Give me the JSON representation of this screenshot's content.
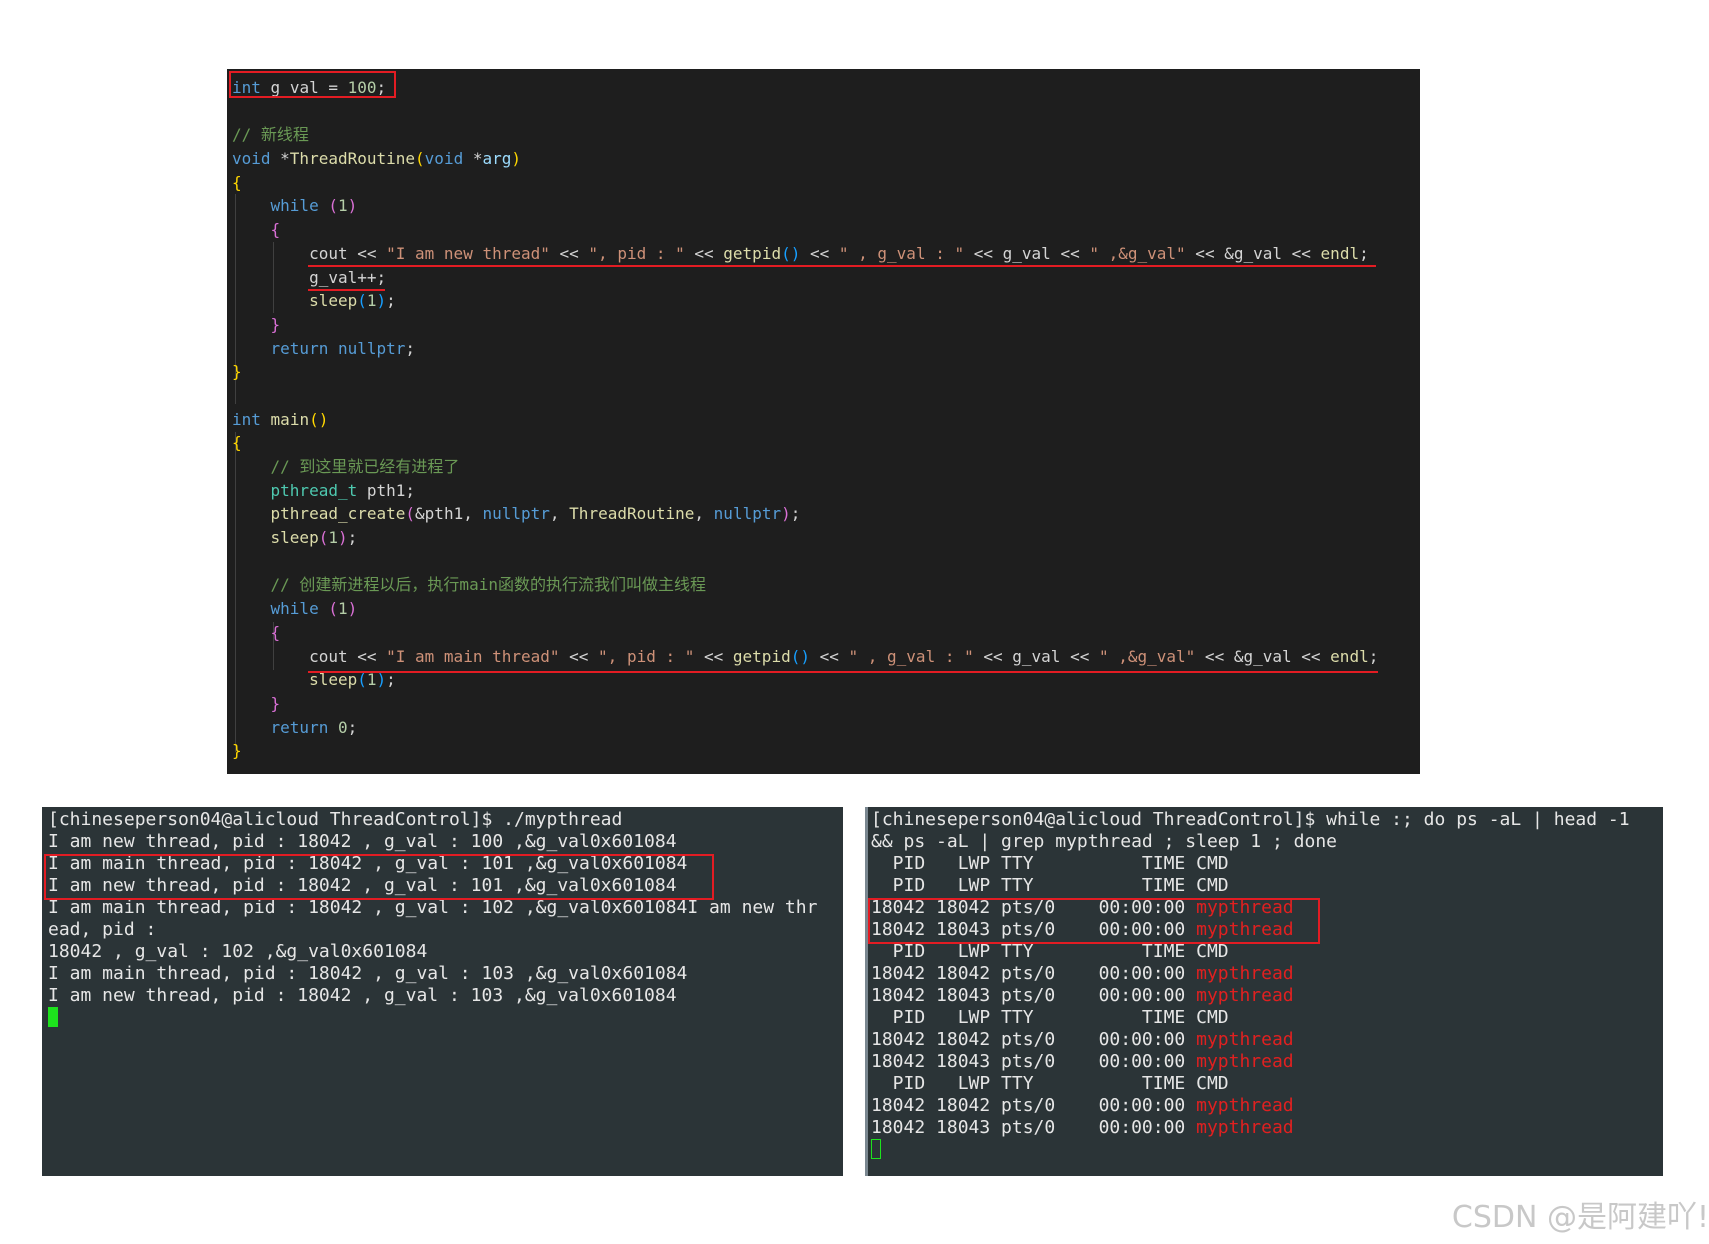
{
  "code_editor": {
    "lines": [
      "int g_val = 100;",
      "",
      "// 新线程",
      "void *ThreadRoutine(void *arg)",
      "{",
      "    while (1)",
      "    {",
      "        cout << \"I am new thread\" << \", pid : \" << getpid() << \" , g_val : \" << g_val << \" ,&g_val\" << &g_val << endl;",
      "        g_val++;",
      "        sleep(1);",
      "    }",
      "    return nullptr;",
      "}",
      "",
      "int main()",
      "{",
      "    // 到这里就已经有进程了",
      "    pthread_t pth1;",
      "    pthread_create(&pth1, nullptr, ThreadRoutine, nullptr);",
      "    sleep(1);",
      "",
      "    // 创建新进程以后，执行main函数的执行流我们叫做主线程",
      "    while (1)",
      "    {",
      "        cout << \"I am main thread\" << \", pid : \" << getpid() << \" , g_val : \" << g_val << \" ,&g_val\" << &g_val << endl;",
      "        sleep(1);",
      "    }",
      "    return 0;",
      "}"
    ]
  },
  "terminal_left": {
    "lines": [
      "[chineseperson04@alicloud ThreadControl]$ ./mypthread",
      "I am new thread, pid : 18042 , g_val : 100 ,&g_val0x601084",
      "I am main thread, pid : 18042 , g_val : 101 ,&g_val0x601084",
      "I am new thread, pid : 18042 , g_val : 101 ,&g_val0x601084",
      "I am main thread, pid : 18042 , g_val : 102 ,&g_val0x601084I am new thr",
      "ead, pid :",
      "18042 , g_val : 102 ,&g_val0x601084",
      "I am main thread, pid : 18042 , g_val : 103 ,&g_val0x601084",
      "I am new thread, pid : 18042 , g_val : 103 ,&g_val0x601084"
    ]
  },
  "terminal_right": {
    "command": [
      "[chineseperson04@alicloud ThreadControl]$ while :; do ps -aL | head -1",
      "&& ps -aL | grep mypthread ; sleep 1 ; done"
    ],
    "rows": [
      {
        "text": "  PID   LWP TTY          TIME CMD",
        "cmd": ""
      },
      {
        "text": "  PID   LWP TTY          TIME CMD",
        "cmd": ""
      },
      {
        "text": "18042 18042 pts/0    00:00:00 ",
        "cmd": "mypthread"
      },
      {
        "text": "18042 18043 pts/0    00:00:00 ",
        "cmd": "mypthread"
      },
      {
        "text": "  PID   LWP TTY          TIME CMD",
        "cmd": ""
      },
      {
        "text": "18042 18042 pts/0    00:00:00 ",
        "cmd": "mypthread"
      },
      {
        "text": "18042 18043 pts/0    00:00:00 ",
        "cmd": "mypthread"
      },
      {
        "text": "  PID   LWP TTY          TIME CMD",
        "cmd": ""
      },
      {
        "text": "18042 18042 pts/0    00:00:00 ",
        "cmd": "mypthread"
      },
      {
        "text": "18042 18043 pts/0    00:00:00 ",
        "cmd": "mypthread"
      },
      {
        "text": "  PID   LWP TTY          TIME CMD",
        "cmd": ""
      },
      {
        "text": "18042 18042 pts/0    00:00:00 ",
        "cmd": "mypthread"
      },
      {
        "text": "18042 18043 pts/0    00:00:00 ",
        "cmd": "mypthread"
      }
    ]
  },
  "watermark": "CSDN @是阿建吖!",
  "colors": {
    "editor_bg": "#1e1e1e",
    "terminal_bg": "#2b3437",
    "highlight_red": "#e31c23",
    "cursor_green": "#1de21d"
  }
}
